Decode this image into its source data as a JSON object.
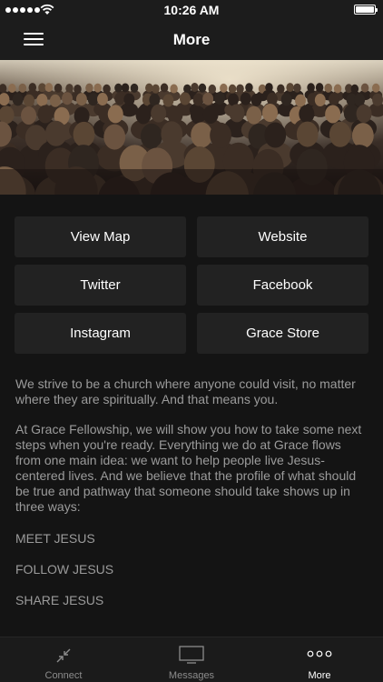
{
  "status_bar": {
    "time": "10:26 AM"
  },
  "nav": {
    "title": "More"
  },
  "buttons": [
    {
      "label": "View Map"
    },
    {
      "label": "Website"
    },
    {
      "label": "Twitter"
    },
    {
      "label": "Facebook"
    },
    {
      "label": "Instagram"
    },
    {
      "label": "Grace Store"
    }
  ],
  "description": {
    "para1": "We strive to be a church where anyone could visit, no matter where they are spiritually. And that means you.",
    "para2": "At Grace Fellowship, we will show you how to take some next steps when you're ready. Everything we do at Grace flows from one main idea: we want to help people live Jesus-centered lives. And we believe that the profile of what should be true and pathway that someone should take shows up in three ways:",
    "step1": "MEET JESUS",
    "step2": "FOLLOW JESUS",
    "step3": "SHARE JESUS"
  },
  "tab_bar": {
    "tabs": [
      {
        "label": "Connect",
        "icon": "connect-icon"
      },
      {
        "label": "Messages",
        "icon": "tv-icon"
      },
      {
        "label": "More",
        "icon": "more-icon"
      }
    ],
    "active": "More"
  },
  "colors": {
    "background": "#141414",
    "button": "#222222",
    "text_muted": "#9b9b9b"
  }
}
